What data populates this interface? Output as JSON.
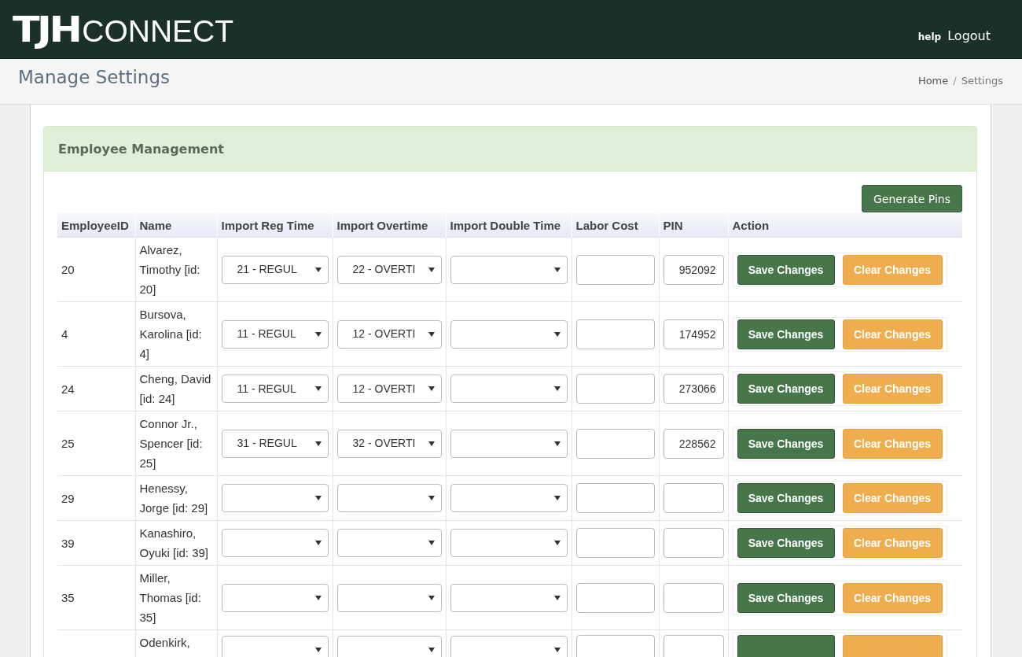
{
  "header": {
    "logo_bold": "TJH",
    "logo_light": "CONNECT",
    "links": [
      "help",
      "Logout"
    ]
  },
  "title_bar": {
    "title": "Manage Settings",
    "breadcrumb_separator": "/",
    "breadcrumb": [
      {
        "label": "Home",
        "selected": false
      },
      {
        "label": "Settings",
        "selected": true
      }
    ]
  },
  "panel": {
    "heading": "Employee Management",
    "generate_button": "Generate Pins",
    "table": {
      "columns": [
        "EmployeeID",
        "Name",
        "Import Reg Time",
        "Import Overtime",
        "Import Double Time",
        "Labor Cost",
        "PIN",
        "Action"
      ],
      "rows": [
        {
          "id": "20",
          "name": "Alvarez, Timothy [id: 20]",
          "reg_time": "21 - REGUL",
          "overtime": "22 - OVERTI",
          "pin": "952092",
          "save": "Save Changes",
          "clear": "Clear Changes"
        },
        {
          "id": "4",
          "name": "Bursova, Karolina [id: 4]",
          "reg_time": "11 - REGUL",
          "overtime": "12 - OVERTI",
          "pin": "174952",
          "save": "Save Changes",
          "clear": "Clear Changes"
        },
        {
          "id": "24",
          "name": "Cheng, David [id: 24]",
          "reg_time": "11 - REGUL",
          "overtime": "12 - OVERTI",
          "pin": "273066",
          "save": "Save Changes",
          "clear": "Clear Changes"
        },
        {
          "id": "25",
          "name": "Connor Jr., Spencer [id: 25]",
          "reg_time": "31 - REGUL",
          "overtime": "32 - OVERTI",
          "pin": "228562",
          "save": "Save Changes",
          "clear": "Clear Changes"
        },
        {
          "id": "29",
          "name": "Henessy, Jorge [id: 29]",
          "save": "Save Changes",
          "clear": "Clear Changes"
        },
        {
          "id": "39",
          "name": "Kanashiro, Oyuki [id: 39]",
          "save": "Save Changes",
          "clear": "Clear Changes"
        },
        {
          "id": "35",
          "name": "Miller, Thomas [id: 35]",
          "save": "Save Changes",
          "clear": "Clear Changes"
        },
        {
          "name": "Odenkirk,"
        }
      ]
    }
  }
}
